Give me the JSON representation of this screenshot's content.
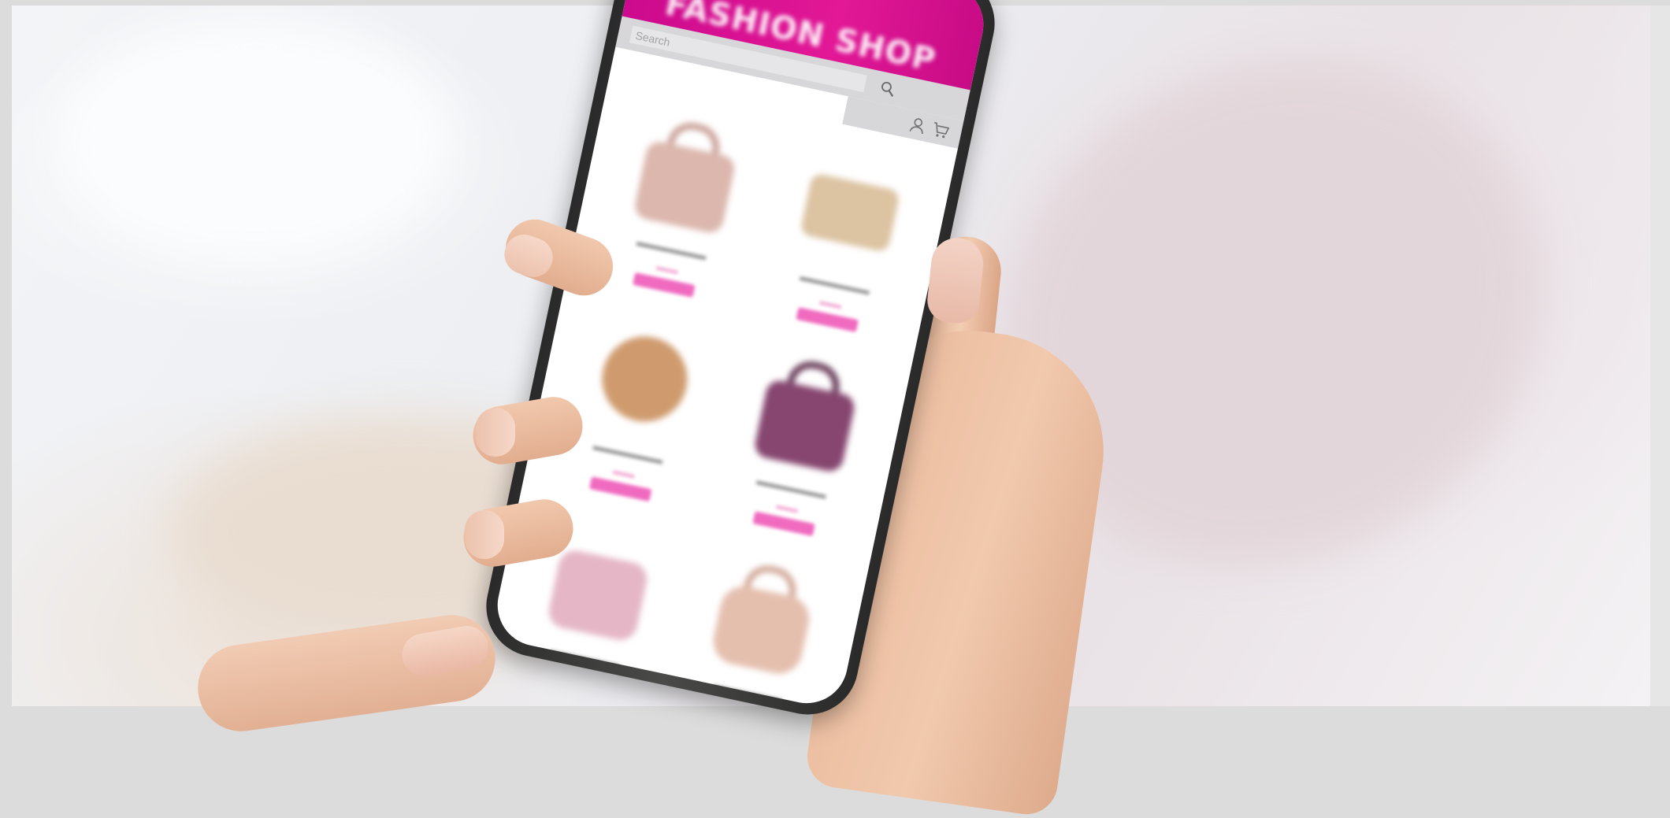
{
  "scene": {
    "description_free": true
  },
  "app": {
    "title": "FASHION SHOP",
    "search": {
      "placeholder": "Search"
    },
    "colors": {
      "header": "#e21896",
      "search_bar": "#d7d7d9",
      "button": "#f06bc0"
    },
    "icons": {
      "search": "search-icon",
      "account": "user-icon",
      "cart": "cart-icon"
    }
  },
  "products": [
    {
      "image": "handbag-pink-tote",
      "color": "#dbb7ad"
    },
    {
      "image": "handbag-beige-clutch",
      "color": "#dcc3a2"
    },
    {
      "image": "handbag-tan-round",
      "color": "#cf9b6e"
    },
    {
      "image": "handbag-purple-tote",
      "color": "#86466f"
    },
    {
      "image": "handbag-pink-flap",
      "color": "#e5b7c6"
    },
    {
      "image": "handbag-peach-backpack",
      "color": "#e5bfae"
    }
  ]
}
